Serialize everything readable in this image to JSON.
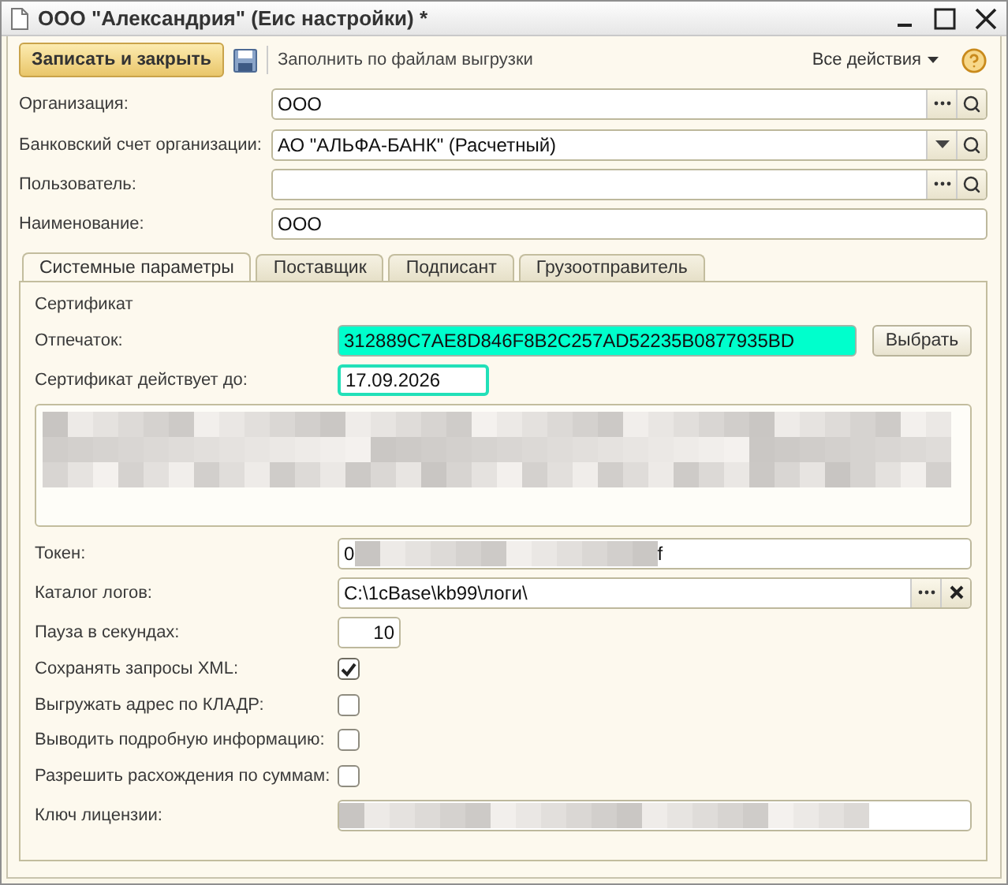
{
  "window": {
    "title": "ООО \"Александрия\" (Еис настройки) *"
  },
  "toolbar": {
    "save_close": "Записать и закрыть",
    "fill": "Заполнить по файлам выгрузки",
    "all_actions": "Все действия"
  },
  "fields": [
    {
      "kind": "select",
      "label": "Организация:",
      "value": "ООО"
    },
    {
      "kind": "dropdown",
      "label": "Банковский счет организации:",
      "value": "АО \"АЛЬФА-БАНК\" (Расчетный)"
    },
    {
      "kind": "select",
      "label": "Пользователь:"
    },
    {
      "kind": "text",
      "label": "Наименование:",
      "value": "ООО"
    }
  ],
  "tabs": [
    {
      "label": "Системные параметры",
      "selected": true
    },
    {
      "label": "Поставщик",
      "selected": false
    },
    {
      "label": "Подписант",
      "selected": false
    },
    {
      "label": "Грузоотправитель",
      "selected": false
    }
  ],
  "certificate": {
    "heading": "Сертификат",
    "thumbprint_label": "Отпечаток:",
    "thumbprint": "312889C7AE8D846F8B2C257AD52235B0877935BD",
    "choose": "Выбрать",
    "valid_label": "Сертификат действует до:",
    "valid_until": "17.09.2026"
  },
  "settings": [
    {
      "kind": "token",
      "label": "Токен:",
      "value_start": "0",
      "value_end": "f"
    },
    {
      "kind": "path",
      "label": "Каталог логов:",
      "value": "C:\\1cBase\\kb99\\логи\\"
    },
    {
      "kind": "number",
      "label": "Пауза в секундах:",
      "value": "10"
    },
    {
      "kind": "checkbox",
      "label": "Сохранять запросы XML:",
      "checked": true
    },
    {
      "kind": "checkbox",
      "label": "Выгружать адрес по КЛАДР:",
      "checked": false
    },
    {
      "kind": "checkbox",
      "label": "Выводить подробную информацию:",
      "checked": false
    },
    {
      "kind": "checkbox",
      "label": "Разрешить расхождения по суммам:",
      "checked": false
    },
    {
      "kind": "license",
      "label": "Ключ лицензии:"
    }
  ]
}
